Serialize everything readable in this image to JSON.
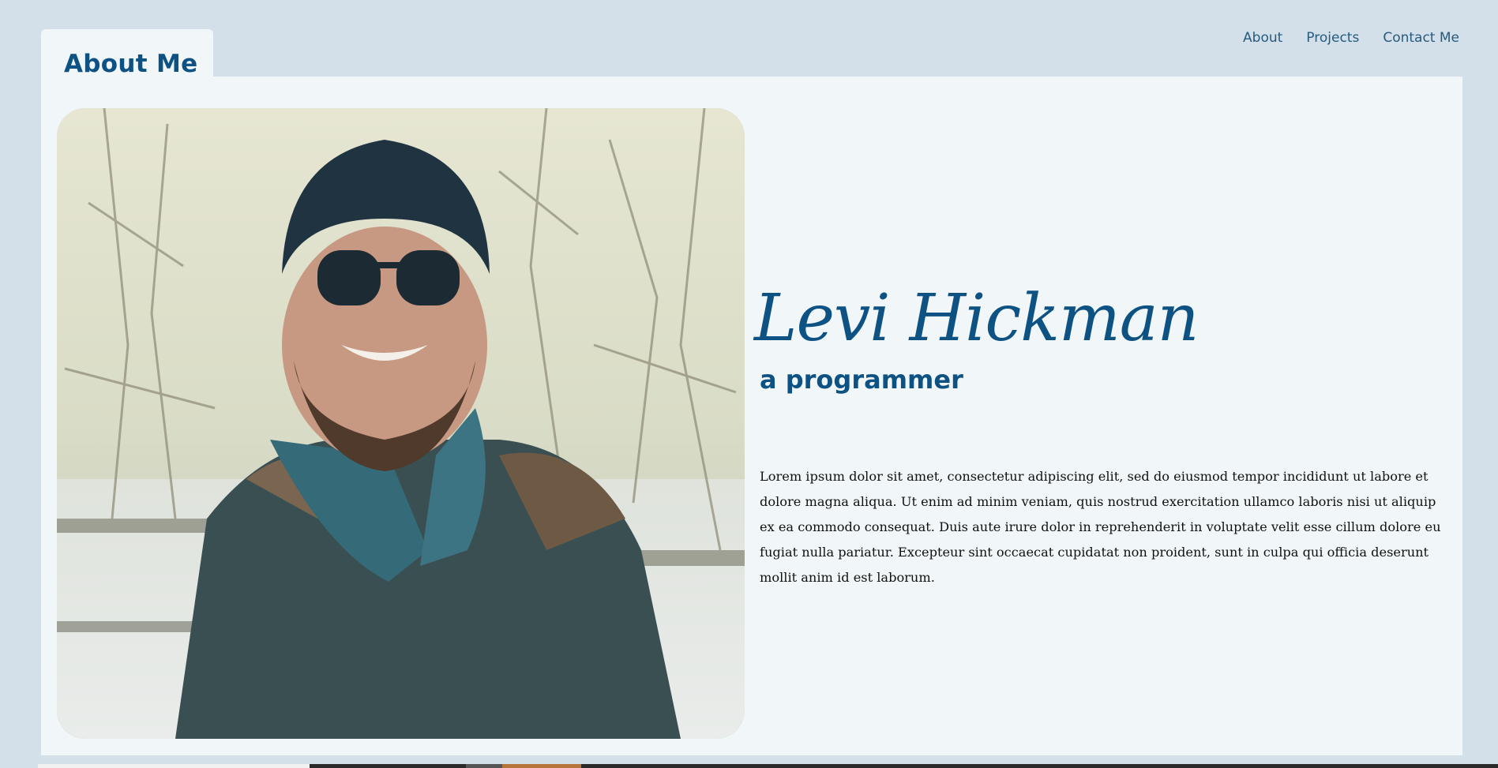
{
  "header": {
    "tab_title": "About Me",
    "nav": [
      {
        "label": "About"
      },
      {
        "label": "Projects"
      },
      {
        "label": "Contact Me"
      }
    ]
  },
  "profile": {
    "name": "Levi Hickman",
    "role": "a programmer",
    "bio": "Lorem ipsum dolor sit amet, consectetur adipiscing elit, sed do eiusmod tempor incididunt ut labore et dolore magna aliqua. Ut enim ad minim veniam, quis nostrud exercitation ullamco laboris nisi ut aliquip ex ea commodo consequat. Duis aute irure dolor in reprehenderit in voluptate velit esse cillum dolore eu fugiat nulla pariatur. Excepteur sint occaecat cupidatat non proident, sunt in culpa qui officia deserunt mollit anim id est laborum."
  },
  "colors": {
    "page_bg": "#d3e0ea",
    "card_bg": "#f1f6f9",
    "accent": "#0d5283",
    "nav_text": "#275b7d"
  }
}
